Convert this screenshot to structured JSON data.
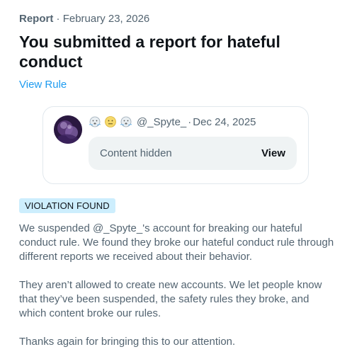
{
  "header": {
    "report_label": "Report",
    "separator": " · ",
    "date": "February 23, 2026"
  },
  "title": "You submitted a report for hateful conduct",
  "view_rule_link": "View Rule",
  "reported_post": {
    "avatar_icon": "avatar-image",
    "emojis": [
      "wind-face-icon",
      "neutral-face-icon",
      "wind-face-icon"
    ],
    "username": "@_Spyte_",
    "separator": " · ",
    "date": "Dec 24, 2025",
    "content_hidden_text": "Content hidden",
    "view_button": "View"
  },
  "badge": {
    "label": "VIOLATION FOUND",
    "color": "#cdeefd"
  },
  "paragraphs": [
    "We suspended @_Spyte_'s account for breaking our hateful conduct rule. We found they broke our hateful conduct rule through different reports we received about their behavior.",
    "They aren’t allowed to create new accounts. We let people know that they’ve been suspended, the safety rules they broke, and which content broke our rules.",
    "Thanks again for bringing this to our attention."
  ],
  "colors": {
    "link": "#1d9bf0",
    "secondary_text": "#536471",
    "primary_text": "#0f1419"
  }
}
